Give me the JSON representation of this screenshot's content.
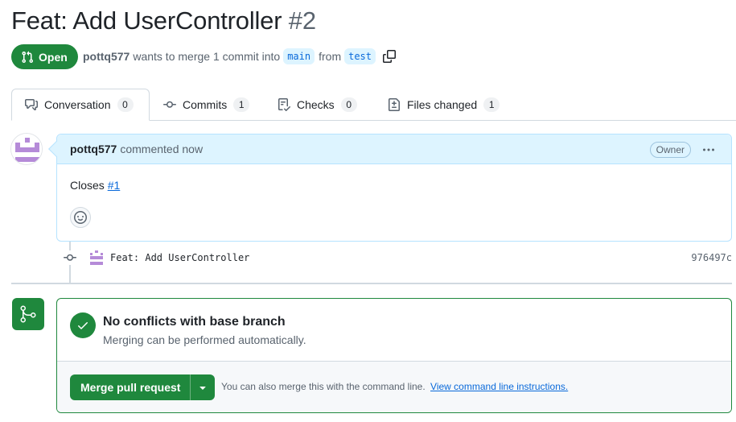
{
  "pr": {
    "title": "Feat: Add UserController",
    "number": "#2",
    "state": "Open",
    "author": "pottq577",
    "merge_text": "wants to merge 1 commit into",
    "base_branch": "main",
    "from_text": "from",
    "head_branch": "test"
  },
  "tabs": [
    {
      "label": "Conversation",
      "count": "0",
      "icon": "comment-discussion-icon"
    },
    {
      "label": "Commits",
      "count": "1",
      "icon": "git-commit-icon"
    },
    {
      "label": "Checks",
      "count": "0",
      "icon": "checklist-icon"
    },
    {
      "label": "Files changed",
      "count": "1",
      "icon": "file-diff-icon"
    }
  ],
  "comment": {
    "author": "pottq577",
    "action": "commented now",
    "role_badge": "Owner",
    "body_text": "Closes",
    "issue_link": "#1"
  },
  "commit": {
    "message": "Feat: Add UserController",
    "sha": "976497c"
  },
  "merge": {
    "heading": "No conflicts with base branch",
    "subtext": "Merging can be performed automatically.",
    "button_label": "Merge pull request",
    "note": "You can also merge this with the command line.",
    "link": "View command line instructions."
  },
  "colors": {
    "success": "#1f883d",
    "accent": "#0969da",
    "comment_header_bg": "#ddf4ff",
    "avatar": "#b58bd8"
  }
}
